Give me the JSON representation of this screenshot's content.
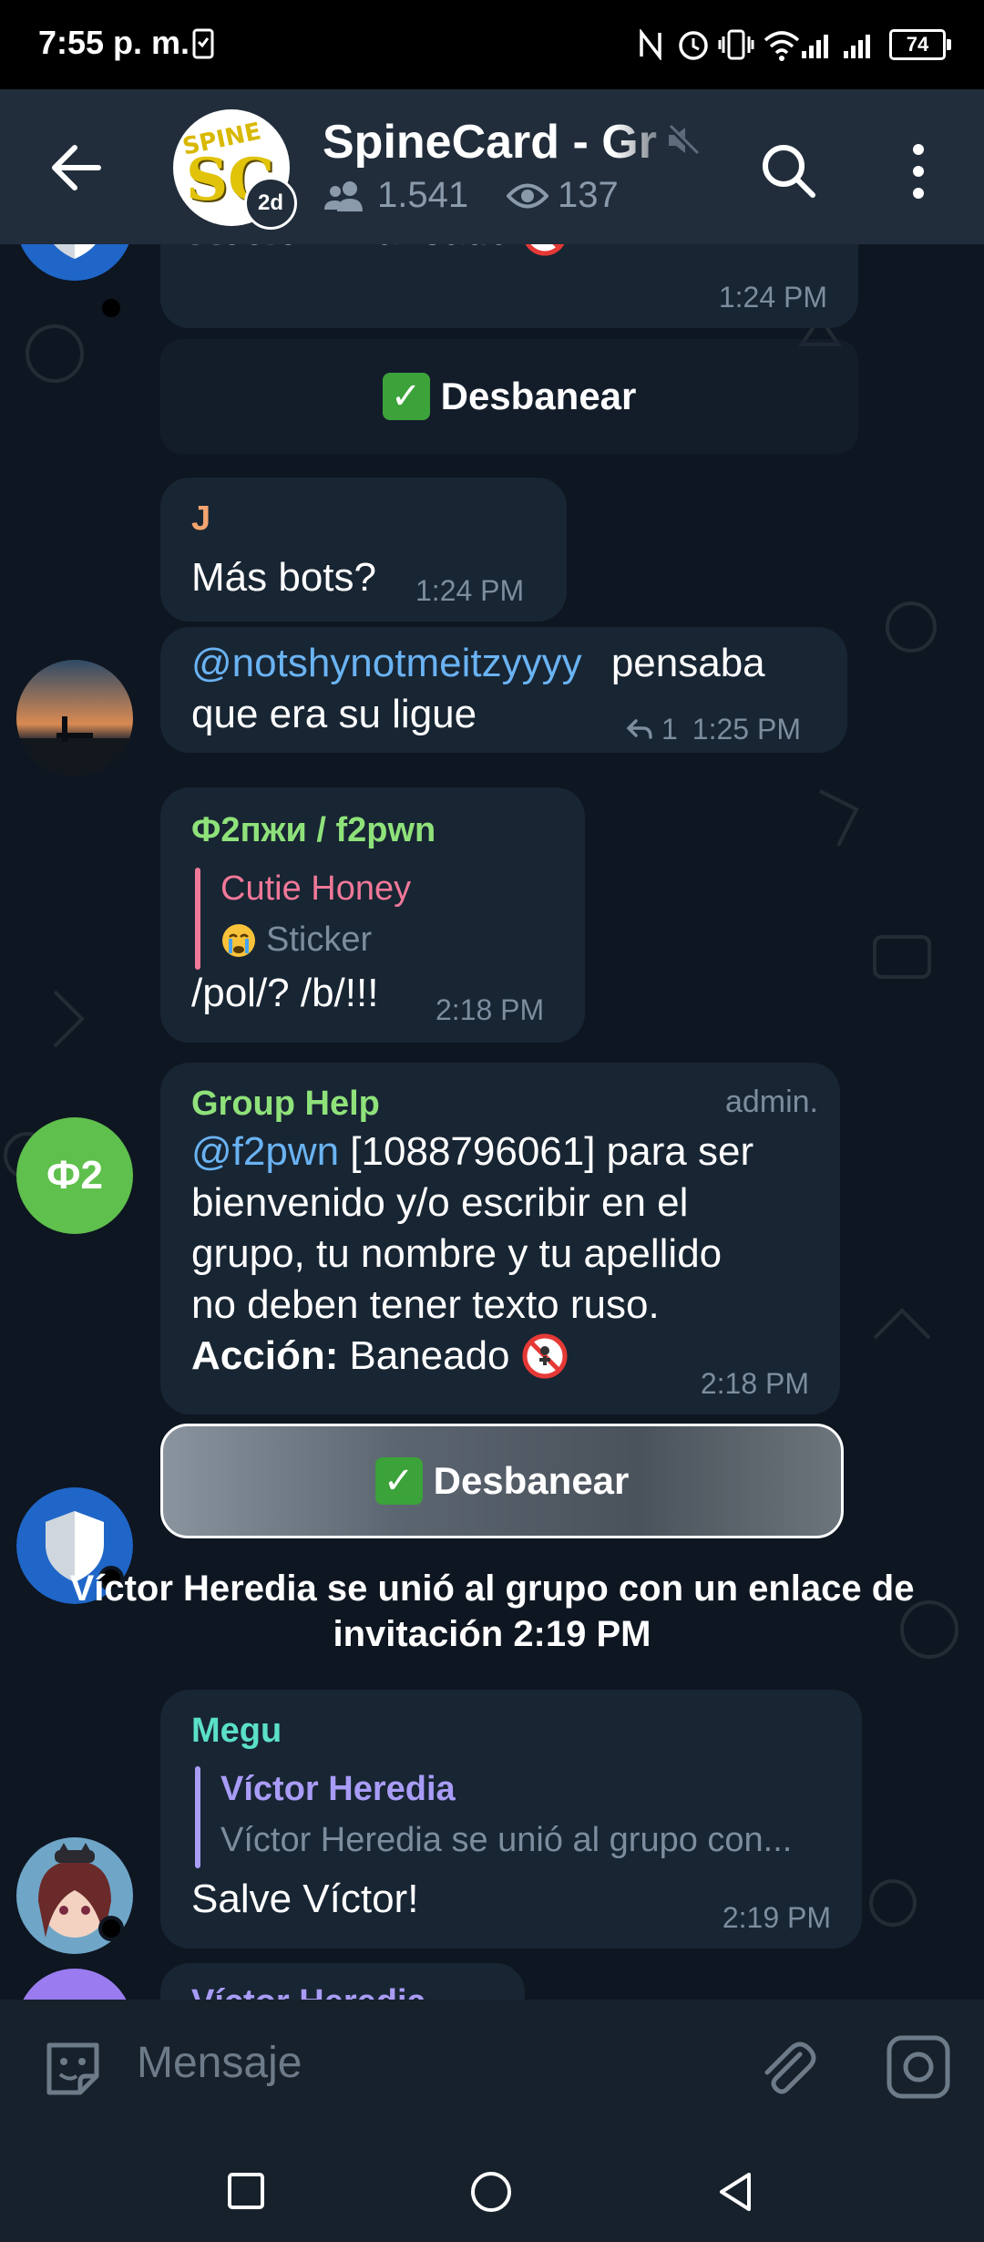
{
  "status_bar": {
    "time": "7:55 p. m.",
    "battery": "74"
  },
  "header": {
    "title": "SpineCard - Gr",
    "avatar_text": "SPINE",
    "avatar_badge": "2d",
    "members": "1.541",
    "views": "137"
  },
  "messages": {
    "m0": {
      "text_label": "Acción:",
      "text": "Baneado",
      "time": "1:24 PM"
    },
    "btn1": {
      "label": "Desbanear"
    },
    "m1": {
      "sender": "J",
      "text": "Más bots?",
      "time": "1:24 PM"
    },
    "m2": {
      "mention": "@notshynotmeitzyyyy",
      "text_line1": "pensaba",
      "text_line2": "que era su ligue",
      "replies": "1",
      "time": "1:25 PM"
    },
    "m3": {
      "sender": "Ф2пжи / f2pwn",
      "avatar_text": "Ф2",
      "reply_name": "Cutie Honey",
      "reply_text": "Sticker",
      "text": "/pol/? /b/!!!",
      "time": "2:18 PM"
    },
    "m4": {
      "sender": "Group Help",
      "role": "admin.",
      "mention": "@f2pwn",
      "line1_rest": " [1088796061] para ser",
      "line2": "bienvenido y/o escribir en el",
      "line3": "grupo, tu nombre y tu apellido",
      "line4": "no deben tener texto ruso.",
      "action_label": "Acción:",
      "action_text": "Baneado",
      "time": "2:18 PM"
    },
    "btn2": {
      "label": "Desbanear"
    },
    "service": {
      "line1": "Víctor Heredia se unió al grupo con un enlace de",
      "line2": "invitación  2:19 PM"
    },
    "m5": {
      "sender": "Megu",
      "reply_name": "Víctor Heredia",
      "reply_text": "Víctor Heredia se unió al grupo con...",
      "text": "Salve Víctor!",
      "time": "2:19 PM"
    },
    "m6": {
      "sender": "Víctor Heredia"
    }
  },
  "input": {
    "placeholder": "Mensaje"
  },
  "colors": {
    "background": "#0e1621",
    "bubble": "#182533",
    "header": "#212d3b",
    "mention": "#6ab3f3",
    "name_j": "#f4a570",
    "name_f2pwn": "#8fe27a",
    "name_grouphelp": "#8fe27a",
    "name_megu": "#5be0c8",
    "name_victor": "#a99cf7",
    "reply_cutie": "#f07898"
  }
}
